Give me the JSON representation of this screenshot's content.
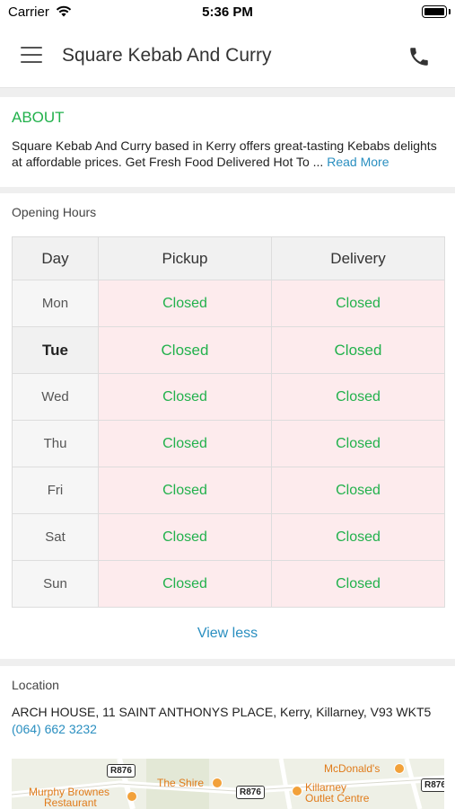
{
  "status_bar": {
    "carrier": "Carrier",
    "time": "5:36 PM"
  },
  "navbar": {
    "title": "Square Kebab And Curry",
    "menu_icon": "hamburger-menu-icon",
    "phone_icon": "phone-icon"
  },
  "about": {
    "title": "ABOUT",
    "text": "Square Kebab And Curry based in Kerry offers great-tasting Kebabs delights at affordable prices. Get Fresh Food Delivered Hot To  ...",
    "read_more": "Read More"
  },
  "opening_hours": {
    "title": "Opening Hours",
    "headers": [
      "Day",
      "Pickup",
      "Delivery"
    ],
    "rows": [
      {
        "day": "Mon",
        "pickup": "Closed",
        "delivery": "Closed"
      },
      {
        "day": "Tue",
        "pickup": "Closed",
        "delivery": "Closed"
      },
      {
        "day": "Wed",
        "pickup": "Closed",
        "delivery": "Closed"
      },
      {
        "day": "Thu",
        "pickup": "Closed",
        "delivery": "Closed"
      },
      {
        "day": "Fri",
        "pickup": "Closed",
        "delivery": "Closed"
      },
      {
        "day": "Sat",
        "pickup": "Closed",
        "delivery": "Closed"
      },
      {
        "day": "Sun",
        "pickup": "Closed",
        "delivery": "Closed"
      }
    ],
    "view_less": "View less"
  },
  "location": {
    "title": "Location",
    "address": "ARCH HOUSE, 11 SAINT ANTHONYS PLACE, Kerry, Killarney, V93 WKT5",
    "phone": "(064) 662 3232",
    "map": {
      "road_r876_a": "R876",
      "road_r876_b": "R876",
      "road_r876_c": "R876",
      "poi_murphy_1": "Murphy Brownes",
      "poi_murphy_2": "Restaurant",
      "poi_shire": "The Shire",
      "poi_mcdonalds": "McDonald's",
      "poi_killarney_1": "Killarney",
      "poi_killarney_2": "Outlet Centre"
    }
  },
  "colors": {
    "accent_green": "#22b14c",
    "link_blue": "#2a8fc0",
    "closed_bg": "#fdebed"
  }
}
